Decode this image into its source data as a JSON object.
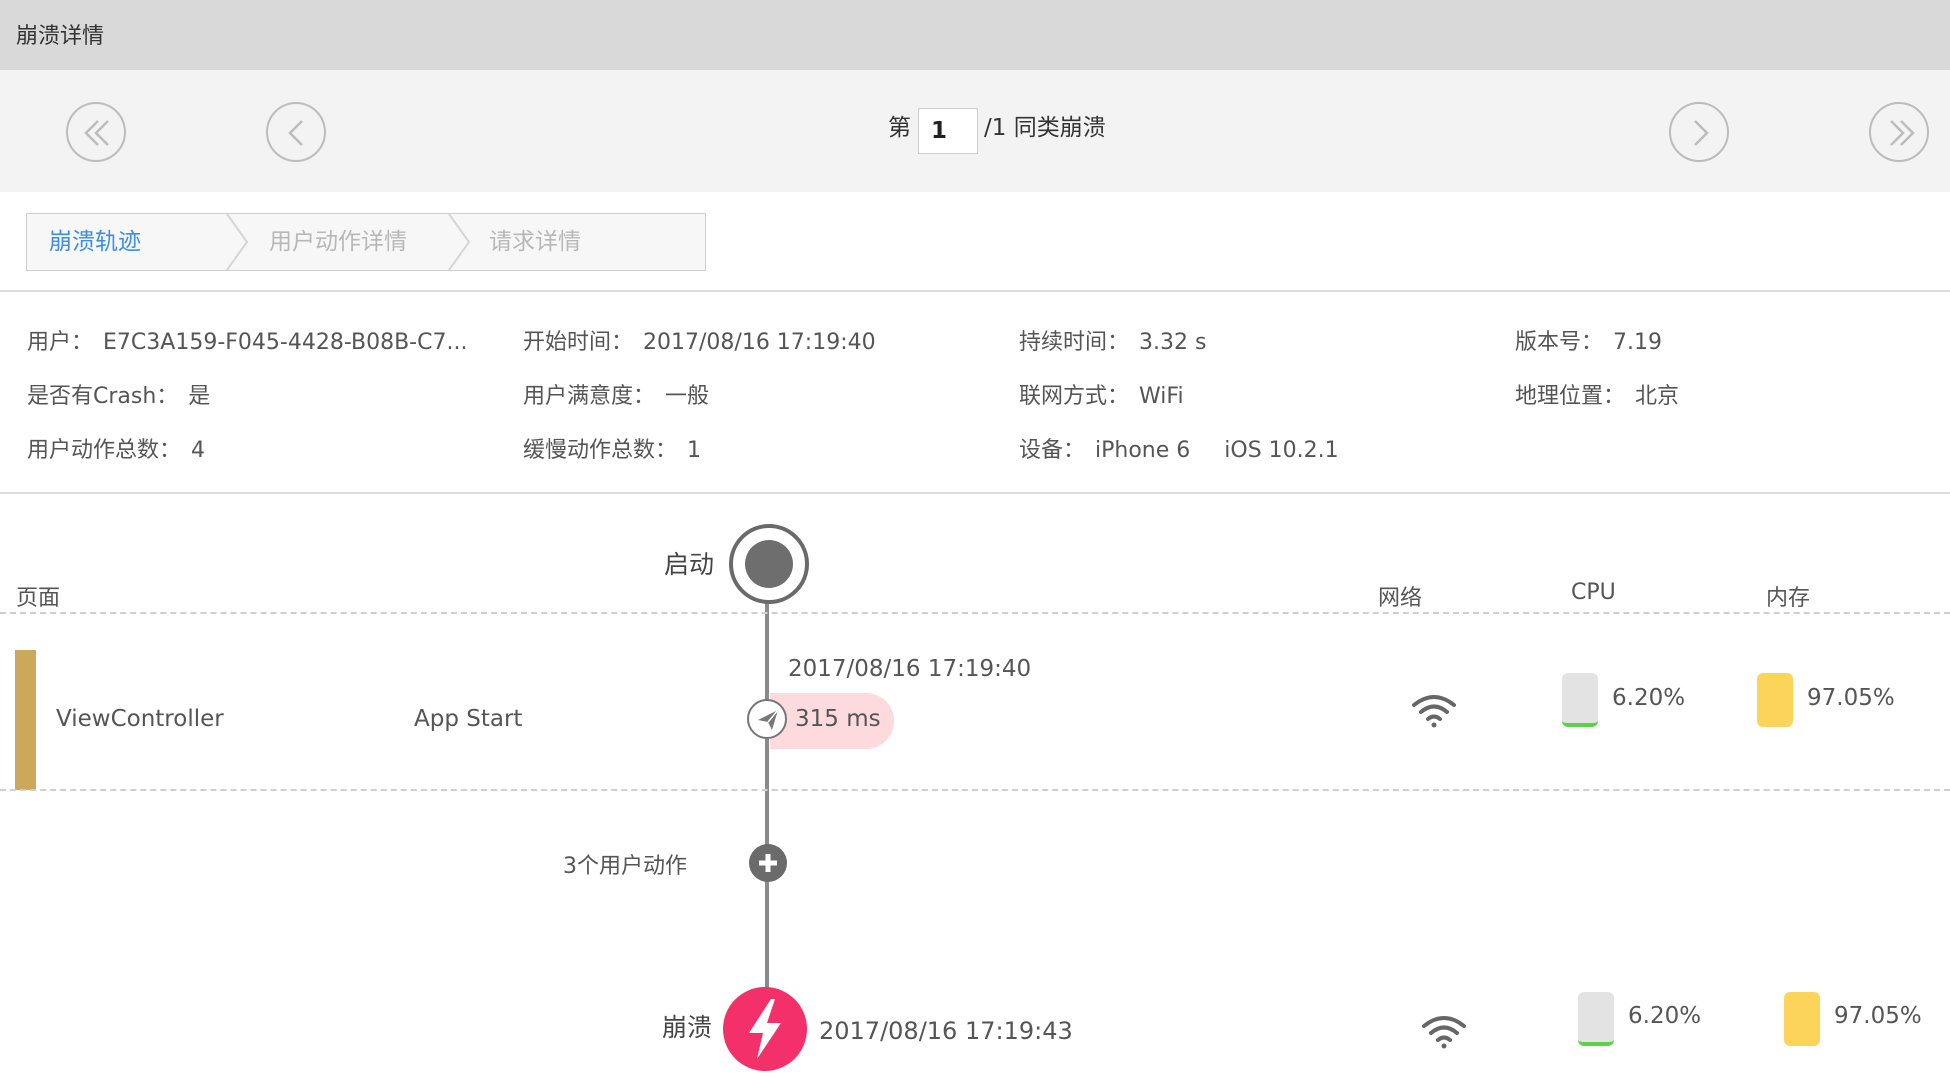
{
  "window": {
    "title": "崩溃详情"
  },
  "pager": {
    "prefix": "第",
    "current_page": "1",
    "suffix": "/1 同类崩溃",
    "first_icon": "double-chevron-left-icon",
    "prev_icon": "chevron-left-icon",
    "next_icon": "chevron-right-icon",
    "last_icon": "double-chevron-right-icon"
  },
  "tabs": [
    {
      "label": "崩溃轨迹",
      "active": true
    },
    {
      "label": "用户动作详情",
      "active": false
    },
    {
      "label": "请求详情",
      "active": false
    }
  ],
  "info": {
    "user": {
      "label": "用户：",
      "value": "E7C3A159-F045-4428-B08B-C7..."
    },
    "start_time": {
      "label": "开始时间：",
      "value": "2017/08/16 17:19:40"
    },
    "duration": {
      "label": "持续时间：",
      "value": "3.32 s"
    },
    "version": {
      "label": "版本号：",
      "value": "7.19"
    },
    "has_crash": {
      "label": "是否有Crash：",
      "value": "是"
    },
    "satisfaction": {
      "label": "用户满意度：",
      "value": "一般"
    },
    "network": {
      "label": "联网方式：",
      "value": "WiFi"
    },
    "location": {
      "label": "地理位置：",
      "value": "北京"
    },
    "action_total": {
      "label": "用户动作总数：",
      "value": "4"
    },
    "slow_total": {
      "label": "缓慢动作总数：",
      "value": "1"
    },
    "device": {
      "label": "设备：",
      "value": "iPhone 6",
      "os": "iOS 10.2.1"
    }
  },
  "timeline": {
    "columns": {
      "page": "页面",
      "network": "网络",
      "cpu": "CPU",
      "memory": "内存"
    },
    "start_label": "启动",
    "row": {
      "page": "ViewController",
      "action": "App Start",
      "time": "2017/08/16 17:19:40",
      "duration": "315 ms",
      "cpu": "6.20%",
      "memory": "97.05%",
      "cpu_level": 0.062,
      "memory_level": 0.9705
    },
    "collapsed_label": "3个用户动作",
    "crash": {
      "label": "崩溃",
      "time": "2017/08/16 17:19:43",
      "cpu": "6.20%",
      "memory": "97.05%"
    }
  },
  "colors": {
    "accent": "#3a8ee6",
    "crash": "#f3306a",
    "page_bar": "#cda85a",
    "memory": "#fcd45a",
    "cpu_fill": "#5bd24a",
    "duration_bg": "#fcdadd"
  }
}
